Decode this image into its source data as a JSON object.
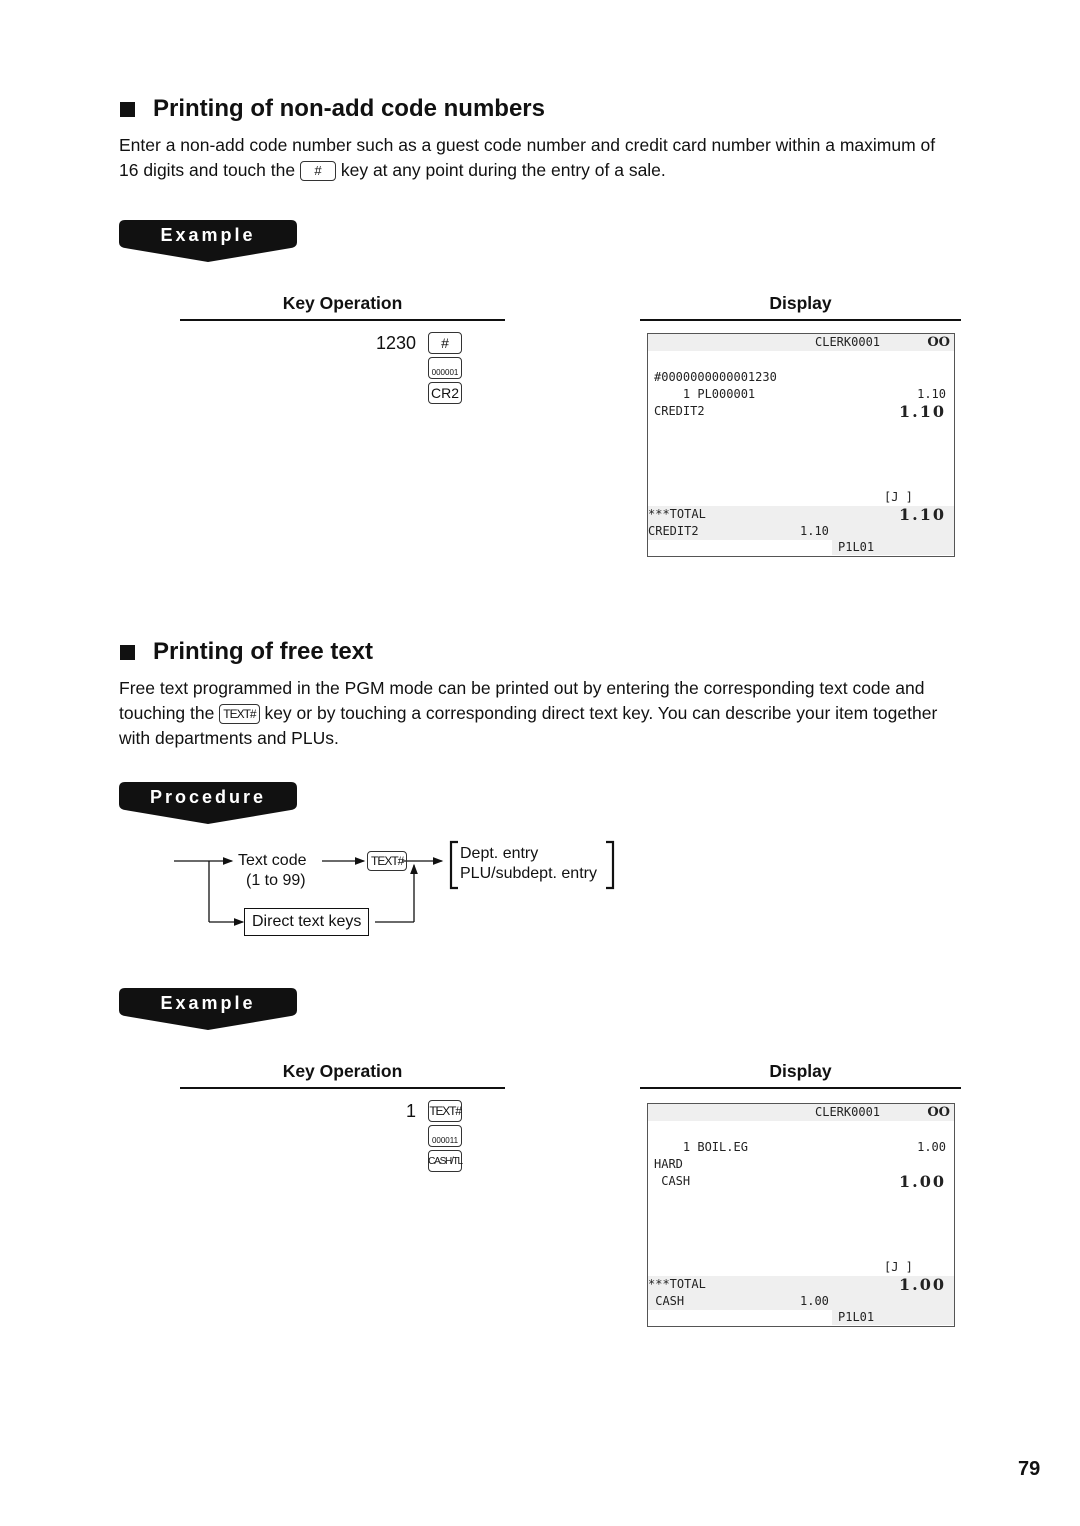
{
  "section1": {
    "title": "Printing of non-add code numbers",
    "para_line1": "Enter a non-add code number such as a guest code number and credit card number within a maximum of",
    "para_line2_before": "16 digits and touch the",
    "para_key": "#",
    "para_line2_after": "key at any point during the entry of a sale.",
    "banner": "Example",
    "key_operation_label": "Key Operation",
    "display_label": "Display",
    "entry_value": "1230",
    "keys": [
      "#",
      "000001",
      "CR2"
    ],
    "display": {
      "header_clerk": "CLERK0001",
      "header_icon": "OO",
      "lines": [
        {
          "left": "#0000000000001230",
          "right": ""
        },
        {
          "left": "    1 PL000001",
          "right": "1.10"
        },
        {
          "left": "CREDIT2",
          "right": "1.10",
          "big": true
        }
      ],
      "journal": "[J ]",
      "total_label": "***TOTAL",
      "total_value": "1.10",
      "tender_label": "CREDIT2",
      "tender_value": "1.10",
      "footer": "P1L01"
    }
  },
  "section2": {
    "title": "Printing of free text",
    "para_line1": "Free text programmed in the PGM mode can be printed out by entering the corresponding text code and",
    "para_line2_before": "touching the",
    "para_key": "TEXT#",
    "para_line2_after": "key or by touching a corresponding direct text key. You can describe your item together",
    "para_line3": "with departments and PLUs.",
    "procedure_banner": "Procedure",
    "flow": {
      "text_code": "Text code",
      "text_code_range": "(1 to 99)",
      "text_key": "TEXT#",
      "direct_keys": "Direct text keys",
      "options": [
        "Dept. entry",
        "PLU/subdept. entry"
      ]
    },
    "banner": "Example",
    "key_operation_label": "Key Operation",
    "display_label": "Display",
    "entry_value": "1",
    "keys": [
      "TEXT#",
      "000011",
      "CASH/TL"
    ],
    "display": {
      "header_clerk": "CLERK0001",
      "header_icon": "OO",
      "lines": [
        {
          "left": "    1 BOIL.EG",
          "right": "1.00"
        },
        {
          "left": "HARD",
          "right": ""
        },
        {
          "left": " CASH",
          "right": "1.00",
          "big": true
        }
      ],
      "journal": "[J ]",
      "total_label": "***TOTAL",
      "total_value": "1.00",
      "tender_label": " CASH",
      "tender_value": "1.00",
      "footer": "P1L01"
    }
  },
  "page_number": "79"
}
